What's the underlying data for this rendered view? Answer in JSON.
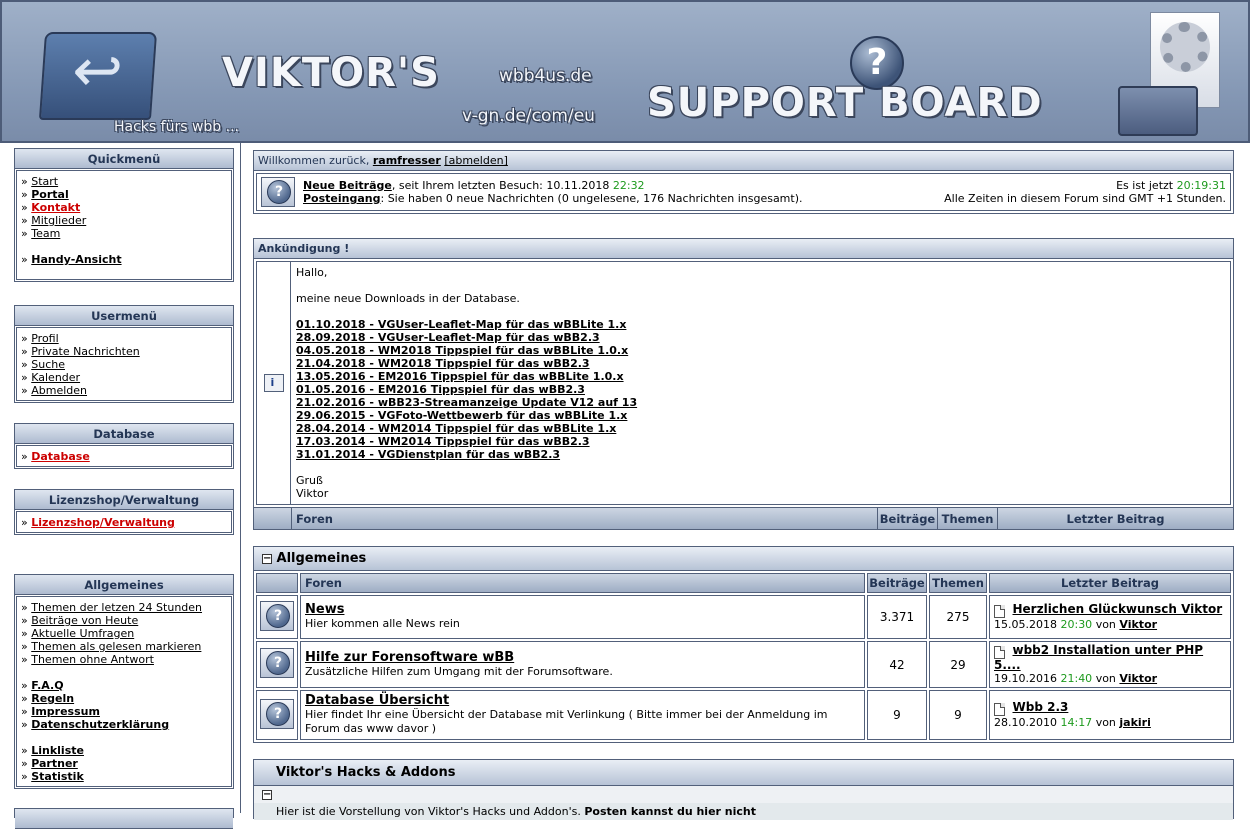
{
  "header": {
    "title": "VIKTOR'S",
    "url1": "wbb4us.de",
    "url2": "v-gn.de/com/eu",
    "subtitle": "Hacks fürs wbb ...",
    "support": "SUPPORT BOARD"
  },
  "sidebar": {
    "quickmenu": {
      "title": "Quickmenü",
      "items": [
        "Start",
        "Portal",
        "Kontakt",
        "Mitglieder",
        "Team"
      ],
      "mobile": "Handy-Ansicht"
    },
    "usermenu": {
      "title": "Usermenü",
      "items": [
        "Profil",
        "Private Nachrichten",
        "Suche",
        "Kalender",
        "Abmelden"
      ]
    },
    "database": {
      "title": "Database",
      "item": "Database"
    },
    "lizenz": {
      "title": "Lizenzshop/Verwaltung",
      "item": "Lizenzshop/Verwaltung"
    },
    "allgemeines": {
      "title": "Allgemeines",
      "group1": [
        "Themen der letzen 24 Stunden",
        "Beiträge von Heute",
        "Aktuelle Umfragen",
        "Themen als gelesen markieren",
        "Themen ohne Antwort"
      ],
      "group2": [
        "F.A.Q",
        "Regeln",
        "Impressum",
        "Datenschutzerklärung"
      ],
      "group3": [
        "Linkliste",
        "Partner",
        "Statistik"
      ]
    }
  },
  "welcome": {
    "prefix": "Willkommen zurück,",
    "user": "ramfresser",
    "logout": "[abmelden]",
    "new_posts_label": "Neue Beiträge",
    "new_posts_text": ", seit Ihrem letzten Besuch: 10.11.2018",
    "new_posts_time": "22:32",
    "inbox_label": "Posteingang",
    "inbox_text": ": Sie haben 0 neue Nachrichten (0 ungelesene, 176 Nachrichten insgesamt).",
    "now_prefix": "Es ist jetzt",
    "now_time": "20:19:31",
    "tz": "Alle Zeiten in diesem Forum sind GMT +1 Stunden."
  },
  "announcement": {
    "title": "Ankündigung !",
    "hello": "Hallo,",
    "intro": "meine neue Downloads in der Database.",
    "links": [
      "01.10.2018 - VGUser-Leaflet-Map für das wBBLite 1.x",
      "28.09.2018 - VGUser-Leaflet-Map für das wBB2.3",
      "04.05.2018 - WM2018 Tippspiel für das wBBLite 1.0.x",
      "21.04.2018 - WM2018 Tippspiel für das wBB2.3",
      "13.05.2016 - EM2016 Tippspiel für das wBBLite 1.0.x",
      "01.05.2016 - EM2016 Tippspiel für das wBB2.3",
      "21.02.2016 - wBB23-Streamanzeige Update V12 auf 13",
      "29.06.2015 - VGFoto-Wettbewerb für das wBBLite 1.x",
      "28.04.2014 - WM2014 Tippspiel für das wBBLite 1.x",
      "17.03.2014 - WM2014 Tippspiel für das wBB2.3",
      "31.01.2014 - VGDienstplan für das wBB2.3"
    ],
    "greeting": "Gruß",
    "name": "Viktor"
  },
  "columns": {
    "foren": "Foren",
    "beitraege": "Beiträge",
    "themen": "Themen",
    "letzter": "Letzter Beitrag"
  },
  "category1": {
    "title": "Allgemeines",
    "forums": [
      {
        "name": "News",
        "desc": "Hier kommen alle News rein",
        "posts": "3.371",
        "topics": "275",
        "last_title": "Herzlichen Glückwunsch Viktor",
        "last_date": "15.05.2018",
        "last_time": "20:30",
        "by": "von",
        "last_user": "Viktor"
      },
      {
        "name": "Hilfe zur Forensoftware wBB",
        "desc": "Zusätzliche Hilfen zum Umgang mit der Forumsoftware.",
        "posts": "42",
        "topics": "29",
        "last_title": "wbb2 Installation unter PHP 5....",
        "last_date": "19.10.2016",
        "last_time": "21:40",
        "by": "von",
        "last_user": "Viktor"
      },
      {
        "name": "Database Übersicht",
        "desc": "Hier findet Ihr eine Übersicht der Database mit Verlinkung ( Bitte immer bei der Anmeldung im Forum das www davor )",
        "posts": "9",
        "topics": "9",
        "last_title": "Wbb 2.3",
        "last_date": "28.10.2010",
        "last_time": "14:17",
        "by": "von",
        "last_user": "jakiri"
      }
    ]
  },
  "category2": {
    "title": "Viktor's Hacks & Addons",
    "desc_start": "Hier ist die Vorstellung von Viktor's Hacks und Addon's.",
    "desc_bold": "Posten kannst du hier nicht"
  }
}
